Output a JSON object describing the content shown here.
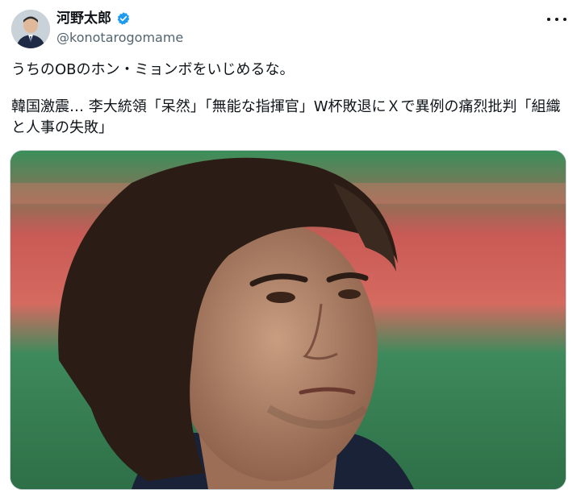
{
  "author": {
    "display_name": "河野太郎",
    "handle": "@konotarogomame",
    "verified": true,
    "avatar_icon": "avatar-photo"
  },
  "tweet": {
    "line1": "うちのOBのホン・ミョンボをいじめるな。",
    "line2": "韓国激震… 李大統領「呆然」「無能な指揮官」W杯敗退にＸで異例の痛烈批判「組織と人事の失敗」"
  },
  "icons": {
    "more": "more-dots-icon",
    "verified": "verified-badge-icon"
  },
  "colors": {
    "verified": "#1d9bf0",
    "text": "#0f1419",
    "secondary": "#536471"
  }
}
